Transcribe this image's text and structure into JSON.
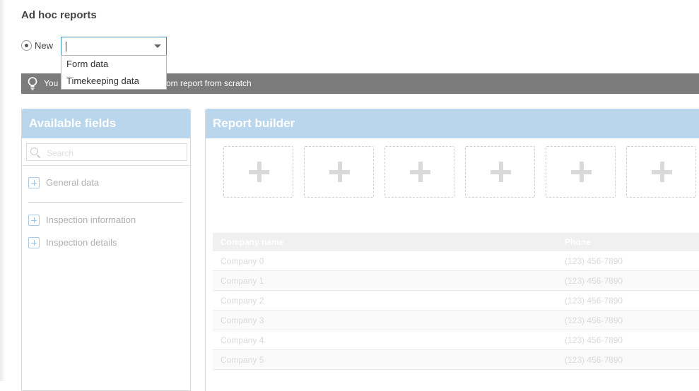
{
  "page": {
    "title": "Ad hoc reports"
  },
  "new_report": {
    "radio_label": "New",
    "combo_value": "",
    "dropdown_options": [
      "Form data",
      "Timekeeping data"
    ]
  },
  "tip": {
    "visible_text_start": "You",
    "visible_text_end": "om report from scratch"
  },
  "available_fields": {
    "title": "Available fields",
    "search_placeholder": "Search",
    "groups": [
      "General data",
      "Inspection information",
      "Inspection details"
    ]
  },
  "report_builder": {
    "title": "Report builder",
    "slot_count": 6,
    "columns": [
      "Company name",
      "Phone"
    ],
    "rows": [
      [
        "Company 0",
        "(123) 456-7890"
      ],
      [
        "Company 1",
        "(123) 456-7890"
      ],
      [
        "Company 2",
        "(123) 456-7890"
      ],
      [
        "Company 3",
        "(123) 456-7890"
      ],
      [
        "Company 4",
        "(123) 456-7890"
      ],
      [
        "Company 5",
        "(123) 456-7890"
      ]
    ]
  },
  "colors": {
    "header_blue": "#b9d6ec",
    "tip_gray": "#7b7b7b",
    "focus_blue": "#3e8fb0"
  },
  "icons": [
    "lightbulb-icon",
    "search-icon",
    "plus-icon",
    "chevron-down-icon",
    "radio-icon"
  ]
}
